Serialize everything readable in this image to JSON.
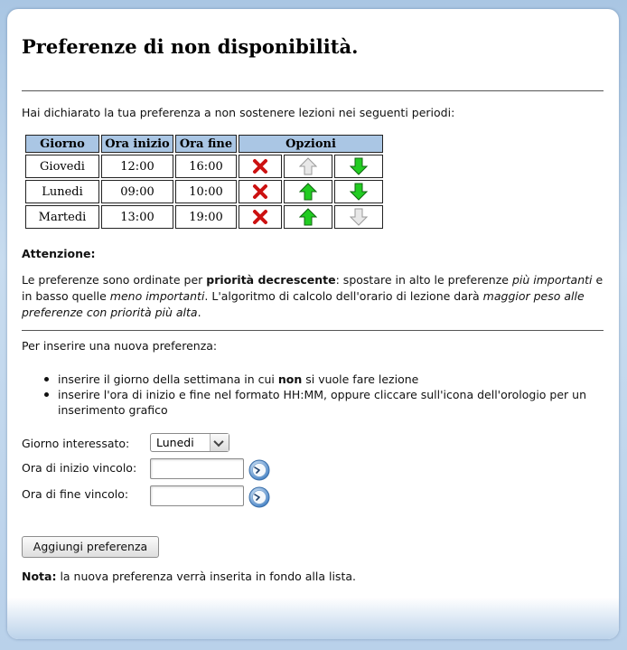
{
  "page": {
    "title": "Preferenze di non disponibilità.",
    "intro": "Hai dichiarato la tua preferenza a non sostenere lezioni nei seguenti periodi:"
  },
  "table": {
    "headers": [
      "Giorno",
      "Ora inizio",
      "Ora fine",
      "Opzioni"
    ],
    "rows": [
      {
        "day": "Giovedi",
        "start": "12:00",
        "end": "16:00",
        "up_enabled": false,
        "down_enabled": true
      },
      {
        "day": "Lunedi",
        "start": "09:00",
        "end": "10:00",
        "up_enabled": true,
        "down_enabled": true
      },
      {
        "day": "Martedi",
        "start": "13:00",
        "end": "19:00",
        "up_enabled": true,
        "down_enabled": false
      }
    ],
    "icons": {
      "delete": "delete-x-icon",
      "up": "arrow-up-icon",
      "down": "arrow-down-icon"
    },
    "colors": {
      "header_bg": "#aac6e4",
      "delete": "#cc1111",
      "arrow_active": "#22cc22",
      "arrow_disabled": "#e8e8e8"
    }
  },
  "attention": {
    "heading": "Attenzione:",
    "t1": "Le preferenze sono ordinate per ",
    "t2": "priorità decrescente",
    "t3": ": spostare in alto le preferenze ",
    "t4": "più importanti",
    "t5": " e in basso quelle ",
    "t6": "meno importanti",
    "t7": ". L'algoritmo di calcolo dell'orario di lezione darà ",
    "t8": "maggior peso alle preferenze con priorità più alta",
    "t9": "."
  },
  "instructions": {
    "intro": "Per inserire una nuova preferenza:",
    "b1_pre": "inserire il giorno della settimana in cui ",
    "b1_bold": "non",
    "b1_post": " si vuole fare lezione",
    "b2": "inserire l'ora di inizio e fine nel formato HH:MM, oppure cliccare sull'icona dell'orologio per un inserimento grafico"
  },
  "form": {
    "day_label": "Giorno interessato:",
    "day_value": "Lunedi",
    "start_label": "Ora di inizio vincolo:",
    "start_value": "",
    "end_label": "Ora di fine vincolo:",
    "end_value": "",
    "submit_label": "Aggiungi preferenza"
  },
  "note": {
    "label": "Nota:",
    "text": " la nuova preferenza verrà inserita in fondo alla lista."
  }
}
